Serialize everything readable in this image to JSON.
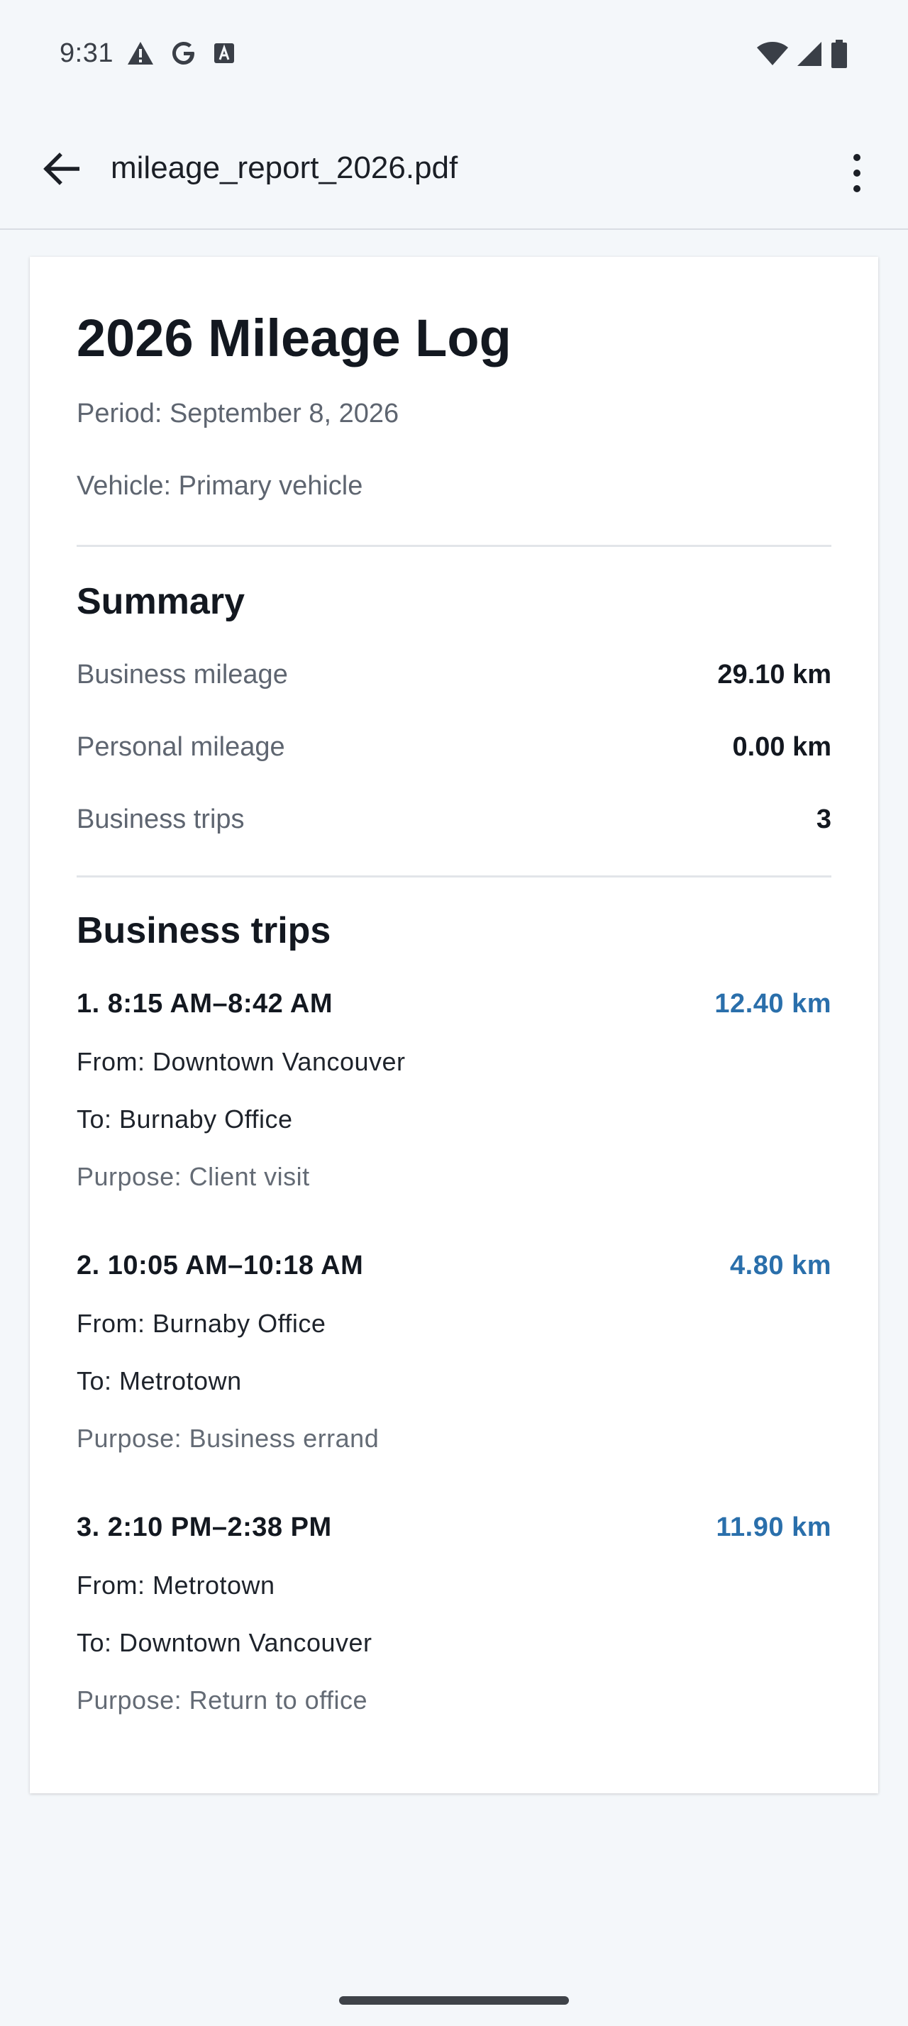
{
  "status_bar": {
    "time": "9:31",
    "left_icons": [
      "alert-icon",
      "google-icon",
      "font-icon"
    ],
    "right_icons": [
      "wifi-icon",
      "signal-icon",
      "battery-icon"
    ]
  },
  "app_bar": {
    "file_name": "mileage_report_2026.pdf",
    "back_icon": "arrow-left-icon",
    "menu_icon": "more-vertical-icon"
  },
  "document": {
    "title": "2026 Mileage Log",
    "period": "Period: September 8, 2026",
    "vehicle": "Vehicle: Primary vehicle",
    "summary": {
      "heading": "Summary",
      "rows": [
        {
          "label": "Business mileage",
          "value": "29.10 km"
        },
        {
          "label": "Personal mileage",
          "value": "0.00 km"
        },
        {
          "label": "Business trips",
          "value": "3"
        }
      ]
    },
    "trips": {
      "heading": "Business trips",
      "items": [
        {
          "time": "1. 8:15 AM–8:42 AM",
          "distance": "12.40 km",
          "from": "From: Downtown Vancouver",
          "to": "To: Burnaby Office",
          "purpose": "Purpose: Client visit"
        },
        {
          "time": "2. 10:05 AM–10:18 AM",
          "distance": "4.80 km",
          "from": "From: Burnaby Office",
          "to": "To: Metrotown",
          "purpose": "Purpose: Business errand"
        },
        {
          "time": "3. 2:10 PM–2:38 PM",
          "distance": "11.90 km",
          "from": "From: Metrotown",
          "to": "To: Downtown Vancouver",
          "purpose": "Purpose: Return to office"
        }
      ]
    }
  },
  "colors": {
    "background": "#f4f7fa",
    "accent_distance": "#2a6fab",
    "text_primary": "#131820",
    "text_secondary": "#5e6570"
  }
}
